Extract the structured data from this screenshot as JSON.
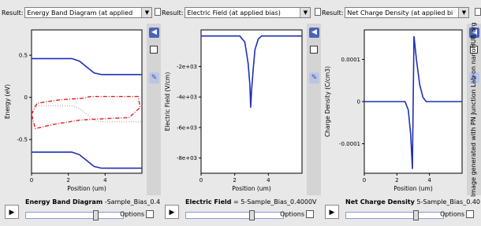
{
  "panels": [
    {
      "result_label": "Result:",
      "select_value": "Energy Band Diagram (at applied",
      "bottom_title_bold": "Energy Band Diagram",
      "bottom_title_rest": " -Sample_Bias_0.4",
      "options_label": "Options"
    },
    {
      "result_label": "Result:",
      "select_value": "Electric Field (at applied bias)",
      "bottom_title_bold": "Electric Field",
      "bottom_title_rest": " = 5-Sample_Bias_0.4000V",
      "options_label": "Options"
    },
    {
      "result_label": "Result:",
      "select_value": "Net Charge Density (at applied bi",
      "bottom_title_bold": "Net Charge Density",
      "bottom_title_rest": " 5-Sample_Bias_0.40",
      "options_label": "Options"
    }
  ],
  "watermark": "Image generated with PN Junction Lab on nanoHUB.org",
  "slider_positions": [
    0.72,
    0.68,
    0.72
  ],
  "colors": {
    "curve": "#1f2fb8",
    "dash": "#e02020",
    "dotted": "#999999",
    "accent": "#4a63b8"
  },
  "icons": {
    "play": "play-icon",
    "panel_toggle": "panel-toggle-icon",
    "settings": "wrench-icon",
    "result_doc": "document-icon"
  },
  "chart_data": [
    {
      "type": "line",
      "xlabel": "Position (um)",
      "ylabel": "Energy (eV)",
      "xlim": [
        0,
        6
      ],
      "ylim": [
        -0.9,
        0.8
      ],
      "xticks": [
        "0",
        "2",
        "4"
      ],
      "yticks": [
        "0.5",
        "0",
        "-0.5"
      ],
      "series": [
        {
          "style": "solid",
          "x": [
            0,
            2.2,
            2.6,
            3.0,
            3.4,
            3.8,
            6
          ],
          "y": [
            0.46,
            0.46,
            0.43,
            0.36,
            0.29,
            0.27,
            0.27
          ]
        },
        {
          "style": "solid",
          "x": [
            0,
            2.2,
            2.6,
            3.0,
            3.4,
            3.8,
            6
          ],
          "y": [
            -0.65,
            -0.65,
            -0.68,
            -0.75,
            -0.82,
            -0.84,
            -0.84
          ]
        },
        {
          "style": "dashdot",
          "x": [
            0,
            0.3,
            1.5,
            2.8,
            3.2,
            5.8,
            5.9,
            5.3,
            3.3,
            2.6,
            1.2,
            0.2,
            0
          ],
          "y": [
            -0.2,
            -0.07,
            -0.03,
            -0.01,
            0.01,
            0.01,
            -0.12,
            -0.24,
            -0.26,
            -0.27,
            -0.32,
            -0.37,
            -0.2
          ]
        },
        {
          "style": "dotted",
          "x": [
            0,
            2.2,
            2.6,
            3.0,
            3.4,
            3.8,
            6
          ],
          "y": [
            -0.1,
            -0.1,
            -0.13,
            -0.2,
            -0.27,
            -0.29,
            -0.29
          ]
        }
      ]
    },
    {
      "type": "line",
      "xlabel": "Position (um)",
      "ylabel": "Electric Field (V/cm)",
      "xlim": [
        0,
        6
      ],
      "ylim": [
        -9000,
        400
      ],
      "xticks": [
        "0",
        "2",
        "4"
      ],
      "yticks": [
        "-2e+03",
        "-4e+03",
        "-6e+03",
        "-8e+03"
      ],
      "series": [
        {
          "style": "solid",
          "x": [
            0,
            2.3,
            2.6,
            2.8,
            2.9,
            2.95,
            3.0,
            3.1,
            3.2,
            3.4,
            3.6,
            6
          ],
          "y": [
            0,
            0,
            -400,
            -1800,
            -3200,
            -4700,
            -3600,
            -2200,
            -900,
            -200,
            0,
            0
          ]
        }
      ]
    },
    {
      "type": "line",
      "xlabel": "Position (um)",
      "ylabel": "Charge Density (C/cm3)",
      "xlim": [
        0,
        6
      ],
      "ylim": [
        -0.00017,
        0.00017
      ],
      "xticks": [
        "0",
        "2",
        "4"
      ],
      "yticks": [
        "0.0001",
        "0",
        "-0.0001"
      ],
      "series": [
        {
          "style": "solid",
          "x": [
            0,
            2.5,
            2.7,
            2.85,
            2.95,
            3.0,
            3.05,
            3.2,
            3.4,
            3.6,
            3.8,
            6
          ],
          "y": [
            0,
            0,
            -2e-05,
            -8e-05,
            -0.00016,
            0,
            0.000155,
            0.0001,
            4e-05,
            1e-05,
            0,
            0
          ]
        }
      ]
    }
  ]
}
